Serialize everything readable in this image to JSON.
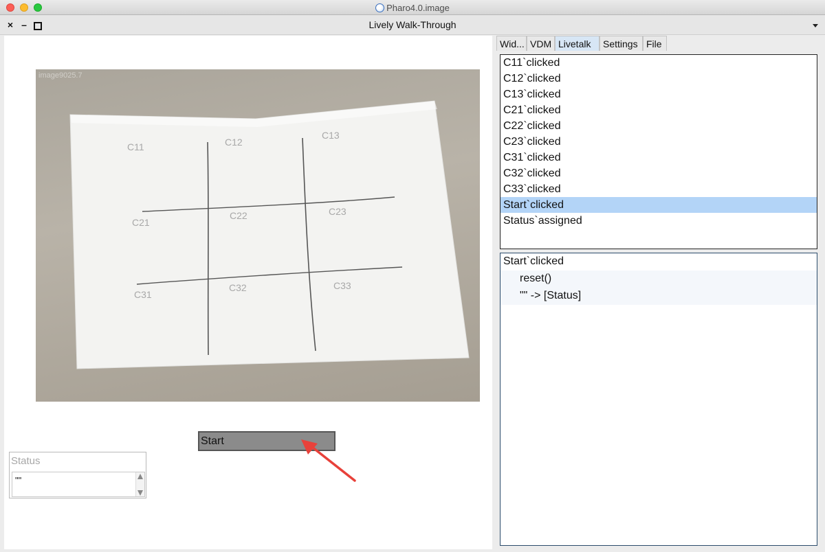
{
  "os_window": {
    "title": "Pharo4.0.image"
  },
  "window": {
    "title": "Lively Walk-Through",
    "close_glyph": "×",
    "minimize_glyph": "–"
  },
  "photo": {
    "name": "image9025.7",
    "cells": {
      "c11": "C11",
      "c12": "C12",
      "c13": "C13",
      "c21": "C21",
      "c22": "C22",
      "c23": "C23",
      "c31": "C31",
      "c32": "C32",
      "c33": "C33"
    }
  },
  "start_button": {
    "label": "Start"
  },
  "status": {
    "label": "Status",
    "value": "\"\""
  },
  "tabs": [
    {
      "label": "Wid..."
    },
    {
      "label": "VDM"
    },
    {
      "label": "Livetalk",
      "active": true
    },
    {
      "label": "Settings"
    },
    {
      "label": "File"
    }
  ],
  "events": [
    "C11`clicked",
    "C12`clicked",
    "C13`clicked",
    "C21`clicked",
    "C22`clicked",
    "C23`clicked",
    "C31`clicked",
    "C32`clicked",
    "C33`clicked",
    "Start`clicked",
    "Status`assigned"
  ],
  "selected_event": "Start`clicked",
  "code": {
    "line1": "Start`clicked",
    "line2": "reset()",
    "line3": "\"\" -> [Status]"
  },
  "colors": {
    "selection": "#b3d4f7",
    "active_tab": "#d7e6f5",
    "arrow": "#e8413a"
  }
}
